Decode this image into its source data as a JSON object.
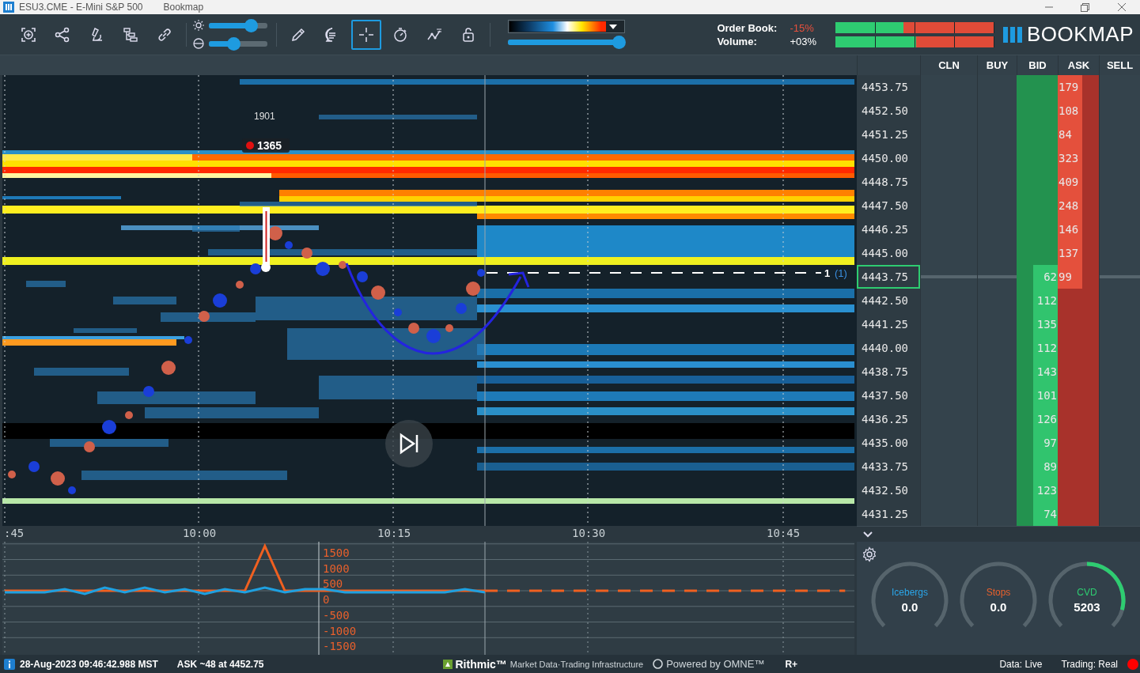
{
  "window": {
    "title": "ESU3.CME - E-Mini S&P 500",
    "app": "Bookmap"
  },
  "toolbar": {
    "tools_left": [
      {
        "kind": "zoom",
        "selected": false
      },
      {
        "kind": "share",
        "selected": false
      },
      {
        "kind": "microscope",
        "selected": false
      },
      {
        "kind": "tree",
        "selected": false
      },
      {
        "kind": "link",
        "selected": false
      }
    ],
    "sliders": [
      {
        "kind": "brightness",
        "level": 0.72
      },
      {
        "kind": "contrast",
        "level": 0.42
      }
    ],
    "tools_right": [
      {
        "kind": "pencil",
        "selected": false
      },
      {
        "kind": "chat",
        "selected": false
      },
      {
        "kind": "crosshair",
        "selected": true
      },
      {
        "kind": "timer",
        "selected": false
      },
      {
        "kind": "chart",
        "selected": false
      },
      {
        "kind": "lock",
        "selected": false
      }
    ],
    "color_scale": {
      "level": 1.0
    }
  },
  "imbalance": [
    {
      "label": "Order Book:",
      "reading": "-15%",
      "negative": true,
      "level": 0.43
    },
    {
      "label": "Volume:",
      "reading": "+03%",
      "negative": false,
      "level": 0.51
    }
  ],
  "logo": "BOOKMAP",
  "dom": {
    "columns": [
      "CLN",
      "BUY",
      "BID",
      "ASK",
      "SELL"
    ],
    "rows": [
      {
        "price": "4453.75",
        "ask": "179",
        "selected": false
      },
      {
        "price": "4452.50",
        "ask": "108",
        "selected": false
      },
      {
        "price": "4451.25",
        "ask": "84",
        "selected": false
      },
      {
        "price": "4450.00",
        "ask": "323",
        "selected": false
      },
      {
        "price": "4448.75",
        "ask": "409",
        "selected": false
      },
      {
        "price": "4447.50",
        "ask": "248",
        "selected": false
      },
      {
        "price": "4446.25",
        "ask": "146",
        "selected": false
      },
      {
        "price": "4445.00",
        "ask": "137",
        "selected": false
      },
      {
        "price": "4443.75",
        "bid": "62",
        "ask": "99",
        "selected": true
      },
      {
        "price": "4442.50",
        "bid": "112",
        "selected": false
      },
      {
        "price": "4441.25",
        "bid": "135",
        "selected": false
      },
      {
        "price": "4440.00",
        "bid": "112",
        "selected": false
      },
      {
        "price": "4438.75",
        "bid": "143",
        "selected": false
      },
      {
        "price": "4437.50",
        "bid": "101",
        "selected": false
      },
      {
        "price": "4436.25",
        "bid": "126",
        "selected": false
      },
      {
        "price": "4435.00",
        "bid": "97",
        "selected": false
      },
      {
        "price": "4433.75",
        "bid": "89",
        "selected": false
      },
      {
        "price": "4432.50",
        "bid": "123",
        "selected": false
      },
      {
        "price": "4431.25",
        "bid": "74",
        "selected": false
      }
    ]
  },
  "heatmap": {
    "volume_label": "1901",
    "trade_label": "1365",
    "order_size": "1",
    "order_count": "(1)"
  },
  "time_axis": [
    ":45",
    "10:00",
    "10:15",
    "10:30",
    "10:45"
  ],
  "indicator": {
    "chart_data": {
      "type": "line",
      "grid": true,
      "ylim": [
        -2050,
        1570
      ],
      "yticks": [
        1500,
        1000,
        500,
        0,
        -500,
        -1000,
        -1500
      ],
      "series": [
        {
          "color": "#f06020",
          "values": [
            0,
            0,
            0,
            0,
            0,
            0,
            0,
            0,
            0,
            0,
            0,
            0,
            0,
            1430,
            0,
            0,
            0,
            0,
            0,
            0,
            0,
            0,
            0,
            0,
            0,
            null,
            null,
            null,
            null,
            null,
            null,
            null,
            null,
            null,
            null,
            null,
            null,
            null,
            null,
            null,
            null,
            null,
            null
          ]
        },
        {
          "color": "#1ea0e0",
          "values": [
            -50,
            -50,
            -50,
            50,
            -100,
            100,
            -50,
            100,
            -50,
            50,
            -100,
            50,
            -50,
            100,
            -50,
            50,
            50,
            -50,
            -50,
            -50,
            -50,
            -50,
            -50,
            50,
            -50,
            null,
            null,
            null,
            null,
            null,
            null,
            null,
            null,
            null,
            null,
            null,
            null,
            null,
            null,
            null,
            null,
            null,
            null
          ]
        },
        {
          "color": "#f06020",
          "line_style": "dashed",
          "values": [
            null,
            null,
            null,
            null,
            null,
            null,
            null,
            null,
            null,
            null,
            null,
            null,
            null,
            null,
            null,
            null,
            null,
            null,
            null,
            null,
            null,
            null,
            null,
            null,
            0,
            0,
            0,
            0,
            0,
            0,
            0,
            0,
            0,
            0,
            0,
            0,
            0,
            0,
            0,
            0,
            0,
            0,
            0
          ]
        }
      ]
    }
  },
  "gauges": [
    {
      "label": "Icebergs",
      "value": "0.0",
      "color": "#2aa5e8"
    },
    {
      "label": "Stops",
      "value": "0.0",
      "color": "#e8602c"
    },
    {
      "label": "CVD",
      "value": "5203",
      "level": 0.78,
      "color": "#2ecc71"
    }
  ],
  "status_bar": {
    "timestamp": "28-Aug-2023 09:46:42.988 MST",
    "last_trade": "ASK ~48 at 4452.75",
    "provider": "Rithmic™",
    "provider_tag": "Market Data·Trading Infrastructure",
    "powered": "Powered by OMNE™",
    "mode": "R+",
    "data": "Data: Live",
    "trading": "Trading: Real"
  }
}
